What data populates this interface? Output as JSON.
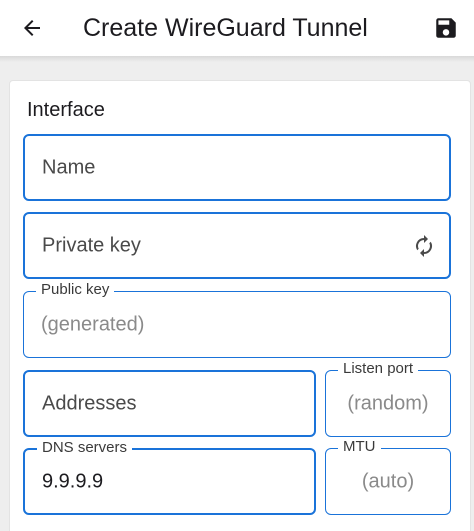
{
  "appbar": {
    "title": "Create WireGuard Tunnel",
    "back_icon": "arrow-left-icon",
    "save_icon": "floppy-disk-icon"
  },
  "interface": {
    "section_title": "Interface",
    "name": {
      "placeholder": "Name"
    },
    "private_key": {
      "placeholder": "Private key",
      "action_icon": "refresh-icon"
    },
    "public_key": {
      "label": "Public key",
      "hint": "(generated)"
    },
    "addresses": {
      "placeholder": "Addresses"
    },
    "listen_port": {
      "label": "Listen port",
      "hint": "(random)"
    },
    "dns_servers": {
      "label": "DNS servers",
      "value": "9.9.9.9"
    },
    "mtu": {
      "label": "MTU",
      "hint": "(auto)"
    }
  },
  "colors": {
    "accent": "#1a73d9",
    "surface": "#ffffff",
    "background": "#eeeeee"
  }
}
